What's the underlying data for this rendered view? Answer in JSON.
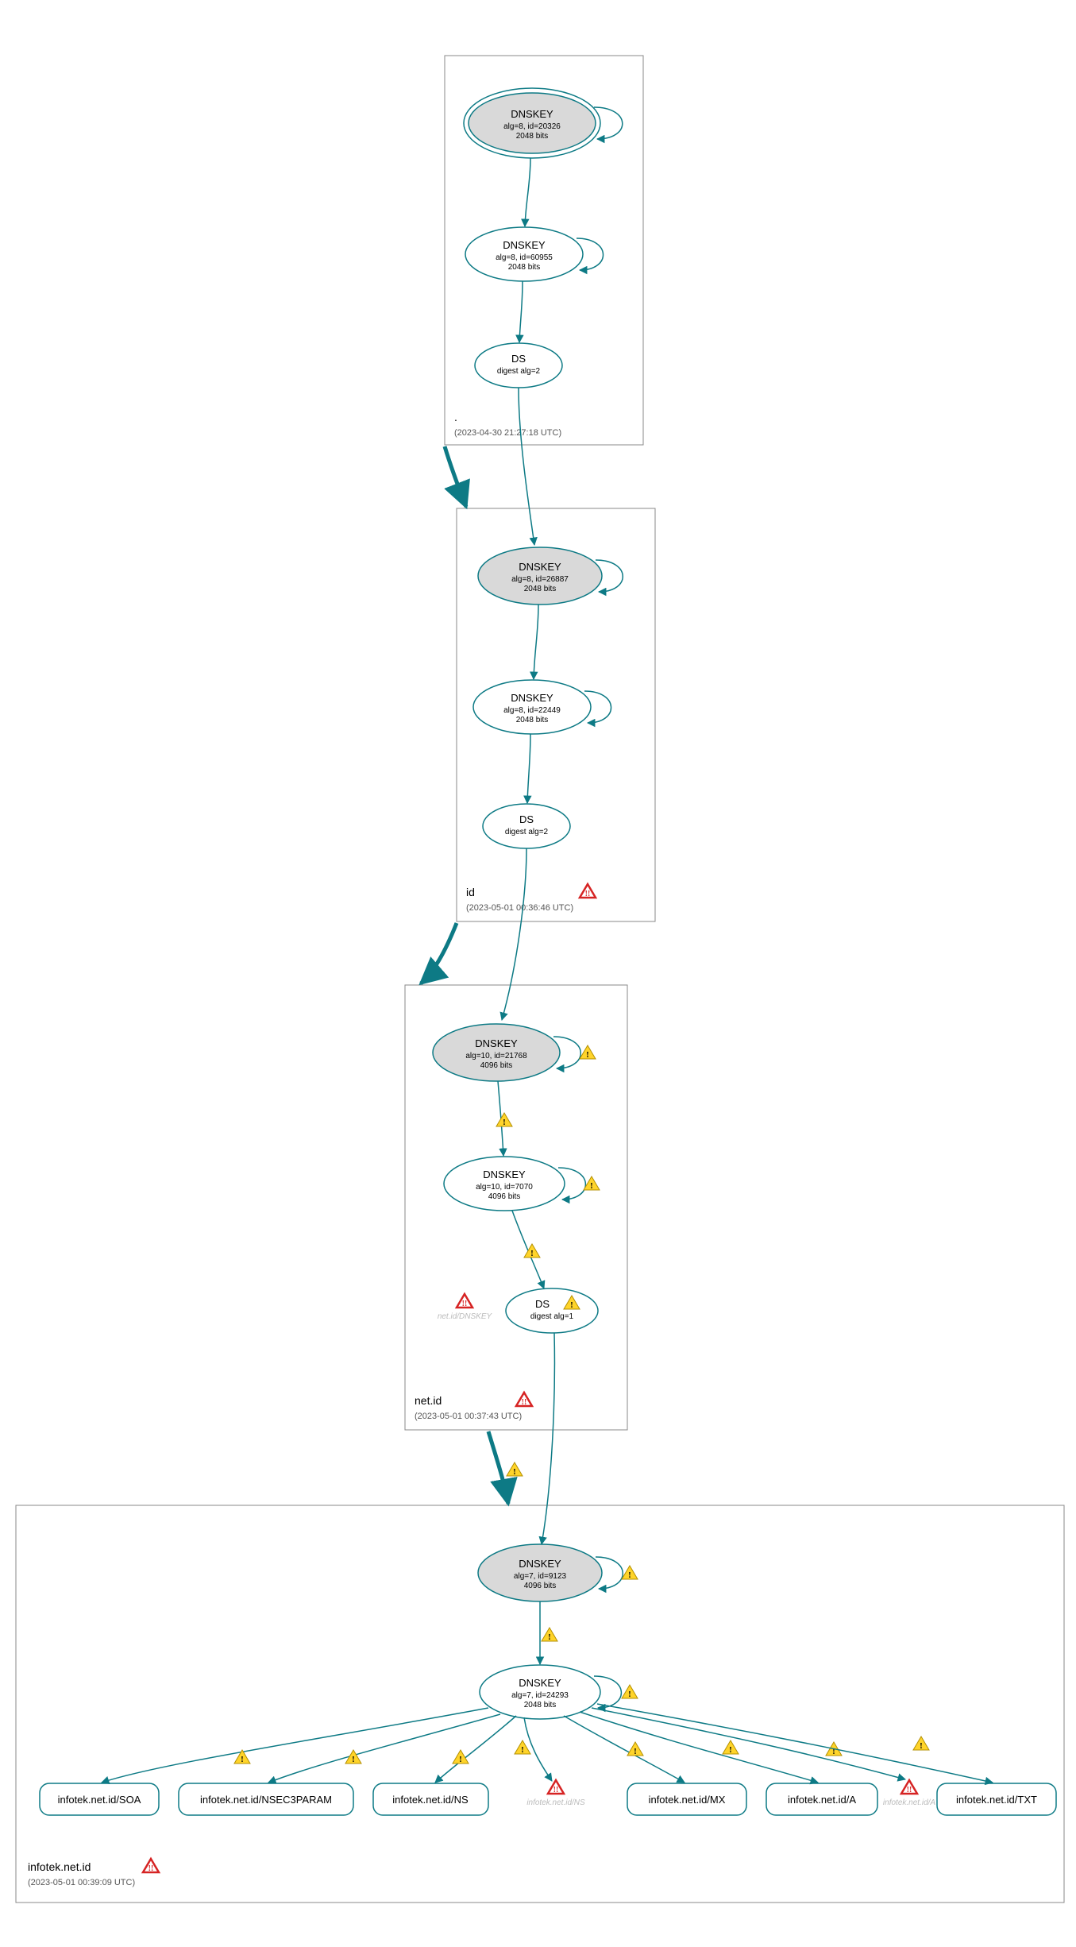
{
  "zones": {
    "root": {
      "label": ".",
      "timestamp": "(2023-04-30 21:27:18 UTC)"
    },
    "id": {
      "label": "id",
      "timestamp": "(2023-05-01 00:36:46 UTC)"
    },
    "netid": {
      "label": "net.id",
      "timestamp": "(2023-05-01 00:37:43 UTC)"
    },
    "leaf": {
      "label": "infotek.net.id",
      "timestamp": "(2023-05-01 00:39:09 UTC)"
    }
  },
  "nodes": {
    "root_ksk": {
      "t": "DNSKEY",
      "l1": "alg=8, id=20326",
      "l2": "2048 bits"
    },
    "root_zsk": {
      "t": "DNSKEY",
      "l1": "alg=8, id=60955",
      "l2": "2048 bits"
    },
    "root_ds": {
      "t": "DS",
      "l1": "digest alg=2"
    },
    "id_ksk": {
      "t": "DNSKEY",
      "l1": "alg=8, id=26887",
      "l2": "2048 bits"
    },
    "id_zsk": {
      "t": "DNSKEY",
      "l1": "alg=8, id=22449",
      "l2": "2048 bits"
    },
    "id_ds": {
      "t": "DS",
      "l1": "digest alg=2"
    },
    "net_ksk": {
      "t": "DNSKEY",
      "l1": "alg=10, id=21768",
      "l2": "4096 bits"
    },
    "net_zsk": {
      "t": "DNSKEY",
      "l1": "alg=10, id=7070",
      "l2": "4096 bits"
    },
    "net_ds": {
      "t": "DS",
      "l1": "digest alg=1"
    },
    "leaf_ksk": {
      "t": "DNSKEY",
      "l1": "alg=7, id=9123",
      "l2": "4096 bits"
    },
    "leaf_zsk": {
      "t": "DNSKEY",
      "l1": "alg=7, id=24293",
      "l2": "2048 bits"
    }
  },
  "ghosts": {
    "netid_dnskey": "net.id/DNSKEY",
    "leaf_ns": "infotek.net.id/NS",
    "leaf_a": "infotek.net.id/A"
  },
  "records": {
    "soa": "infotek.net.id/SOA",
    "nsec": "infotek.net.id/NSEC3PARAM",
    "ns": "infotek.net.id/NS",
    "mx": "infotek.net.id/MX",
    "a": "infotek.net.id/A",
    "txt": "infotek.net.id/TXT"
  },
  "colors": {
    "teal": "#0d7a85",
    "grey": "#d9d9d9",
    "warn": "#ffd42a",
    "err": "#d62323"
  }
}
